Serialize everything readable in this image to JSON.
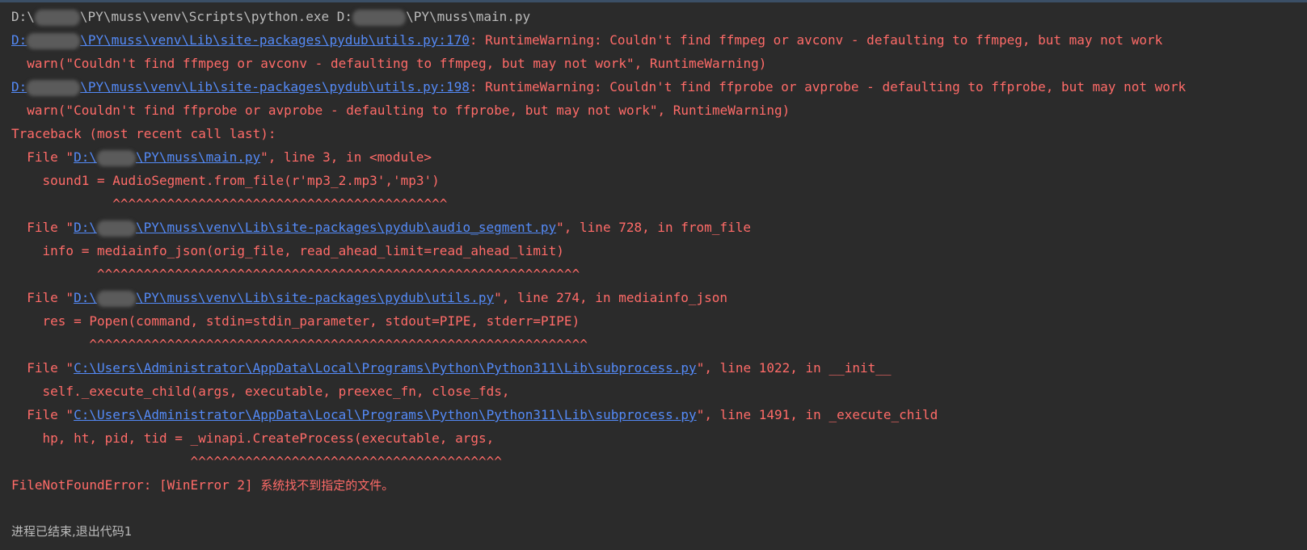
{
  "cmd": {
    "prefix": "D:\\",
    "middle": "\\PY\\muss\\venv\\Scripts\\python.exe D:",
    "suffix": "\\PY\\muss\\main.py"
  },
  "warn1": {
    "link_a": "D:",
    "link_b": "\\PY\\muss\\venv\\Lib\\site-packages\\pydub\\utils.py:170",
    "message": ": RuntimeWarning: Couldn't find ffmpeg or avconv - defaulting to ffmpeg, but may not work",
    "code": "  warn(\"Couldn't find ffmpeg or avconv - defaulting to ffmpeg, but may not work\", RuntimeWarning)"
  },
  "warn2": {
    "link_a": "D:",
    "link_b": "\\PY\\muss\\venv\\Lib\\site-packages\\pydub\\utils.py:198",
    "message": ": RuntimeWarning: Couldn't find ffprobe or avprobe - defaulting to ffprobe, but may not work",
    "code": "  warn(\"Couldn't find ffprobe or avprobe - defaulting to ffprobe, but may not work\", RuntimeWarning)"
  },
  "traceback_header": "Traceback (most recent call last):",
  "frames": {
    "f1": {
      "file_pre": "  File \"",
      "link_a": "D:\\",
      "link_b": "\\PY\\muss\\main.py",
      "file_post": "\", line 3, in <module>",
      "code": "    sound1 = AudioSegment.from_file(r'mp3_2.mp3','mp3')",
      "caret": "             ^^^^^^^^^^^^^^^^^^^^^^^^^^^^^^^^^^^^^^^^^^^"
    },
    "f2": {
      "file_pre": "  File \"",
      "link_a": "D:\\",
      "link_b": "\\PY\\muss\\venv\\Lib\\site-packages\\pydub\\audio_segment.py",
      "file_post": "\", line 728, in from_file",
      "code": "    info = mediainfo_json(orig_file, read_ahead_limit=read_ahead_limit)",
      "caret": "           ^^^^^^^^^^^^^^^^^^^^^^^^^^^^^^^^^^^^^^^^^^^^^^^^^^^^^^^^^^^^^^"
    },
    "f3": {
      "file_pre": "  File \"",
      "link_a": "D:\\",
      "link_b": "\\PY\\muss\\venv\\Lib\\site-packages\\pydub\\utils.py",
      "file_post": "\", line 274, in mediainfo_json",
      "code": "    res = Popen(command, stdin=stdin_parameter, stdout=PIPE, stderr=PIPE)",
      "caret": "          ^^^^^^^^^^^^^^^^^^^^^^^^^^^^^^^^^^^^^^^^^^^^^^^^^^^^^^^^^^^^^^^^"
    },
    "f4": {
      "file_pre": "  File \"",
      "link": "C:\\Users\\Administrator\\AppData\\Local\\Programs\\Python\\Python311\\Lib\\subprocess.py",
      "file_post": "\", line 1022, in __init__",
      "code": "    self._execute_child(args, executable, preexec_fn, close_fds,"
    },
    "f5": {
      "file_pre": "  File \"",
      "link": "C:\\Users\\Administrator\\AppData\\Local\\Programs\\Python\\Python311\\Lib\\subprocess.py",
      "file_post": "\", line 1491, in _execute_child",
      "code": "    hp, ht, pid, tid = _winapi.CreateProcess(executable, args,",
      "caret": "                       ^^^^^^^^^^^^^^^^^^^^^^^^^^^^^^^^^^^^^^^^"
    }
  },
  "error": {
    "prefix": "FileNotFoundError: [WinError 2] ",
    "message": "系统找不到指定的文件。"
  },
  "exit_text": "进程已结束,退出代码1",
  "colors": {
    "background": "#2b2b2b",
    "stderr": "#ff6b68",
    "stdout": "#bbbbbb",
    "link": "#548af7"
  }
}
